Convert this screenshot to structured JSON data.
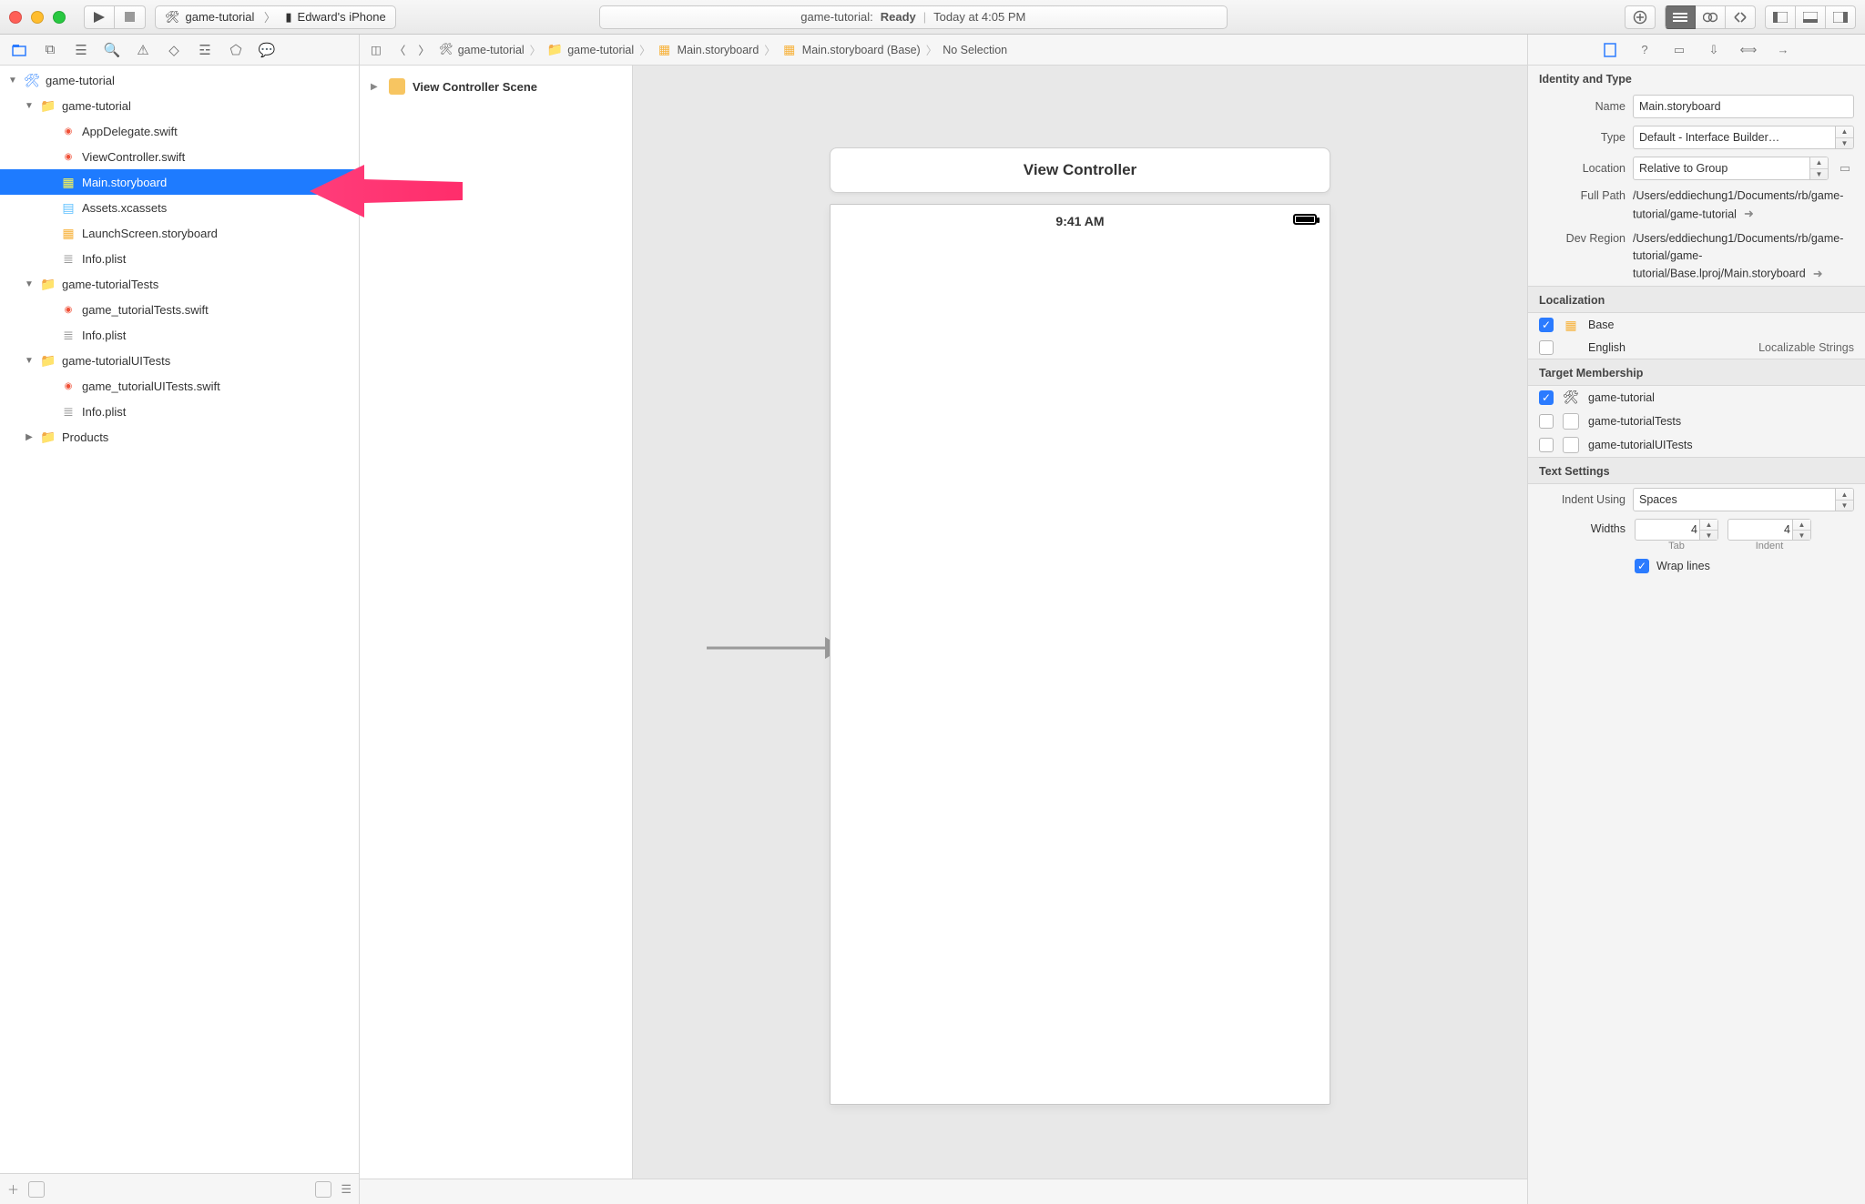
{
  "toolbar": {
    "scheme_target": "game-tutorial",
    "scheme_device": "Edward's iPhone",
    "status_project": "game-tutorial:",
    "status_state": "Ready",
    "status_time": "Today at 4:05 PM"
  },
  "navigator": {
    "project": "game-tutorial",
    "groups": [
      {
        "name": "game-tutorial",
        "files": [
          {
            "name": "AppDelegate.swift",
            "icon": "swift"
          },
          {
            "name": "ViewController.swift",
            "icon": "swift"
          },
          {
            "name": "Main.storyboard",
            "icon": "sb",
            "selected": true
          },
          {
            "name": "Assets.xcassets",
            "icon": "assets"
          },
          {
            "name": "LaunchScreen.storyboard",
            "icon": "sb"
          },
          {
            "name": "Info.plist",
            "icon": "plist"
          }
        ]
      },
      {
        "name": "game-tutorialTests",
        "files": [
          {
            "name": "game_tutorialTests.swift",
            "icon": "swift"
          },
          {
            "name": "Info.plist",
            "icon": "plist"
          }
        ]
      },
      {
        "name": "game-tutorialUITests",
        "files": [
          {
            "name": "game_tutorialUITests.swift",
            "icon": "swift"
          },
          {
            "name": "Info.plist",
            "icon": "plist"
          }
        ]
      }
    ],
    "products": "Products"
  },
  "jumpbar": {
    "crumbs": [
      "game-tutorial",
      "game-tutorial",
      "Main.storyboard",
      "Main.storyboard (Base)",
      "No Selection"
    ]
  },
  "outline": {
    "scene": "View Controller Scene"
  },
  "canvas": {
    "vc_label": "View Controller",
    "phone_time": "9:41 AM"
  },
  "inspector": {
    "identity_header": "Identity and Type",
    "name_label": "Name",
    "name_value": "Main.storyboard",
    "type_label": "Type",
    "type_value": "Default - Interface Builder…",
    "location_label": "Location",
    "location_value": "Relative to Group",
    "fullpath_label": "Full Path",
    "fullpath_value": "/Users/eddiechung1/Documents/rb/game-tutorial/game-tutorial",
    "devregion_label": "Dev Region",
    "devregion_value": "/Users/eddiechung1/Documents/rb/game-tutorial/game-tutorial/Base.lproj/Main.storyboard",
    "localization_header": "Localization",
    "loc_base": "Base",
    "loc_english": "English",
    "loc_english_kind": "Localizable Strings",
    "target_header": "Target Membership",
    "targets": [
      {
        "name": "game-tutorial",
        "checked": true,
        "app": true
      },
      {
        "name": "game-tutorialTests",
        "checked": false,
        "app": false
      },
      {
        "name": "game-tutorialUITests",
        "checked": false,
        "app": false
      }
    ],
    "text_header": "Text Settings",
    "indent_label": "Indent Using",
    "indent_value": "Spaces",
    "widths_label": "Widths",
    "widths_tab": "4",
    "widths_indent": "4",
    "widths_tab_caption": "Tab",
    "widths_indent_caption": "Indent",
    "wrap_label": "Wrap lines"
  }
}
